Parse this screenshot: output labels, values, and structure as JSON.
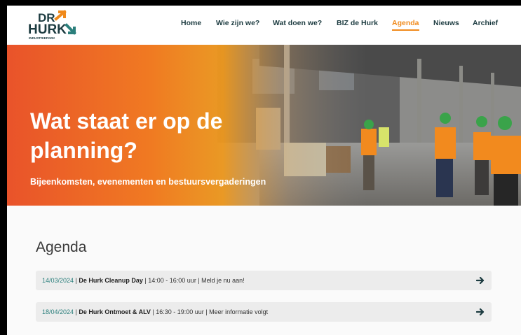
{
  "logo": {
    "line1": "DR",
    "line2": "HURK",
    "tagline": "INDUSTRIEPARK"
  },
  "nav": [
    {
      "label": "Home",
      "active": false
    },
    {
      "label": "Wie zijn we?",
      "active": false
    },
    {
      "label": "Wat doen we?",
      "active": false
    },
    {
      "label": "BIZ de Hurk",
      "active": false
    },
    {
      "label": "Agenda",
      "active": true
    },
    {
      "label": "Nieuws",
      "active": false
    },
    {
      "label": "Archief",
      "active": false
    }
  ],
  "hero": {
    "title": "Wat staat er op de planning?",
    "subtitle": "Bijeenkomsten, evenementen en bestuursvergaderingen"
  },
  "agenda": {
    "heading": "Agenda",
    "items": [
      {
        "date": "14/03/2024",
        "title": "De Hurk Cleanup Day",
        "details": " | 14:00 - 16:00 uur | Meld je nu aan!"
      },
      {
        "date": "18/04/2024",
        "title": "De Hurk Ontmoet & ALV",
        "details": " | 16:30 - 19:00 uur | Meer informatie volgt"
      }
    ]
  },
  "colors": {
    "accent": "#f08a1c",
    "teal": "#2b7f7c",
    "dark": "#1c3b40"
  }
}
